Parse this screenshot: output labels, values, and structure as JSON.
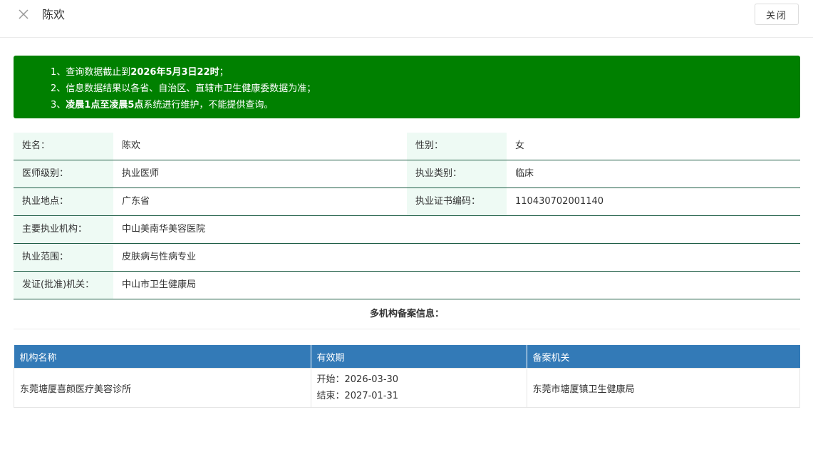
{
  "header": {
    "title": "陈欢",
    "close_label": "关闭"
  },
  "notice": {
    "lines": [
      {
        "prefix": "1、查询数据截止到",
        "bold": "2026年5月3日22时",
        "suffix": "；"
      },
      {
        "prefix": "2、信息数据结果以各省、自治区、直辖市卫生健康委数据为准；",
        "bold": "",
        "suffix": ""
      },
      {
        "prefix": "3、",
        "bold": "凌晨1点至凌晨5点",
        "suffix": "系统进行维护，不能提供查询。"
      }
    ],
    "bg_color": "#008000"
  },
  "info": {
    "name_label": "姓名：",
    "name_value": "陈欢",
    "gender_label": "性别：",
    "gender_value": "女",
    "level_label": "医师级别：",
    "level_value": "执业医师",
    "category_label": "执业类别：",
    "category_value": "临床",
    "location_label": "执业地点：",
    "location_value": "广东省",
    "cert_label": "执业证书编码：",
    "cert_value": "110430702001140",
    "org_label": "主要执业机构：",
    "org_value": "中山美南华美容医院",
    "scope_label": "执业范围：",
    "scope_value": "皮肤病与性病专业",
    "issuer_label": "发证(批准)机关：",
    "issuer_value": "中山市卫生健康局"
  },
  "multi": {
    "title": "多机构备案信息：",
    "columns": [
      "机构名称",
      "有效期",
      "备案机关"
    ],
    "rows": [
      {
        "name": "东莞塘厦喜颜医疗美容诊所",
        "start": "开始：2026-03-30",
        "end": "结束：2027-01-31",
        "authority": "东莞市塘厦镇卫生健康局"
      }
    ],
    "header_color": "#337ab7"
  }
}
